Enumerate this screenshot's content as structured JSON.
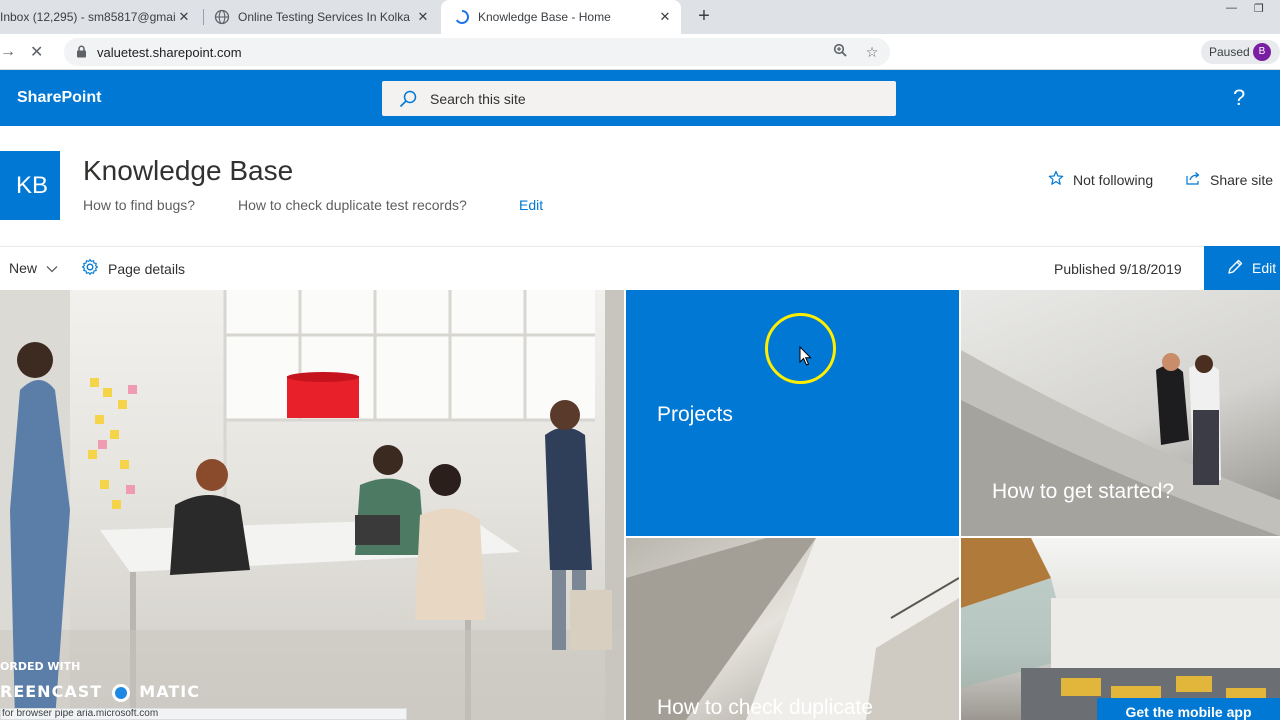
{
  "browser": {
    "tabs": [
      {
        "title": "Inbox (12,295) - sm85817@gmai",
        "favicon": "gmail-icon"
      },
      {
        "title": "Online Testing Services In Kolkat",
        "favicon": "globe-icon"
      },
      {
        "title": "Knowledge Base - Home",
        "favicon": "loading-icon"
      }
    ],
    "url": "valuetest.sharepoint.com",
    "profile_status": "Paused",
    "profile_initial": "B",
    "extension_badge": "2",
    "status_url": "for browser pipe aria.microsoft.com"
  },
  "suite_bar": {
    "brand": "SharePoint",
    "search_placeholder": "Search this site",
    "help": "?"
  },
  "site": {
    "logo_initials": "KB",
    "title": "Knowledge Base",
    "nav_links": [
      "How to find bugs?",
      "How to check duplicate test records?"
    ],
    "nav_edit": "Edit",
    "follow_label": "Not following",
    "share_label": "Share site"
  },
  "command_bar": {
    "new_label": "New",
    "page_details_label": "Page details",
    "published_label": "Published 9/18/2019",
    "edit_label": "Edit"
  },
  "hero": {
    "tiles": [
      {
        "caption": ""
      },
      {
        "caption": "Projects"
      },
      {
        "caption": "How to get started?"
      },
      {
        "caption": "How to check duplicate"
      },
      {
        "caption": ""
      }
    ],
    "mobile_app_label": "Get the mobile app"
  },
  "watermark": {
    "line1": "ORDED WITH",
    "line2_left": "REENCAST",
    "line2_right": "MATIC"
  },
  "colors": {
    "brand": "#0078d4",
    "suite_bar": "#0078d4",
    "cursor_highlight": "#ffee00"
  }
}
